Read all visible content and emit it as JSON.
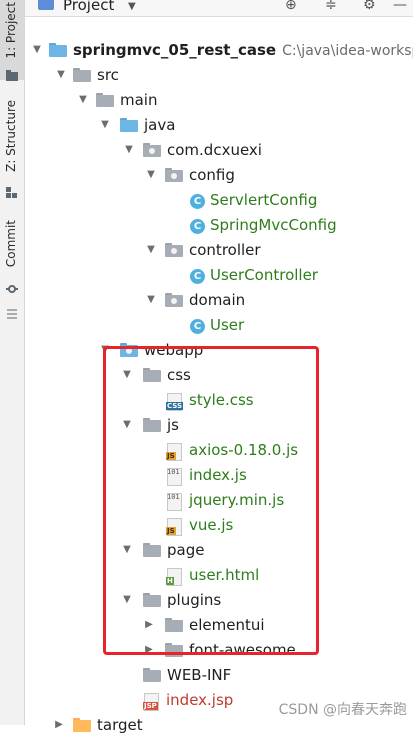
{
  "sidebar": {
    "tabs": [
      {
        "label": "1: Project",
        "icon": "folder-icon"
      },
      {
        "label": "Z: Structure",
        "icon": "structure-icon"
      },
      {
        "label": "Commit",
        "icon": "commit-icon"
      }
    ]
  },
  "header": {
    "title": "Project"
  },
  "tree": {
    "root": {
      "label": "springmvc_05_rest_case",
      "path": "C:\\java\\idea-workspa"
    },
    "items": [
      {
        "label": "src"
      },
      {
        "label": "main"
      },
      {
        "label": "java"
      },
      {
        "label": "com.dcxuexi"
      },
      {
        "label": "config"
      },
      {
        "label": "ServlertConfig"
      },
      {
        "label": "SpringMvcConfig"
      },
      {
        "label": "controller"
      },
      {
        "label": "UserController"
      },
      {
        "label": "domain"
      },
      {
        "label": "User"
      },
      {
        "label": "webapp"
      },
      {
        "label": "css"
      },
      {
        "label": "style.css"
      },
      {
        "label": "js"
      },
      {
        "label": "axios-0.18.0.js"
      },
      {
        "label": "index.js"
      },
      {
        "label": "jquery.min.js"
      },
      {
        "label": "vue.js"
      },
      {
        "label": "page"
      },
      {
        "label": "user.html"
      },
      {
        "label": "plugins"
      },
      {
        "label": "elementui"
      },
      {
        "label": "font-awesome"
      },
      {
        "label": "WEB-INF"
      },
      {
        "label": "index.jsp"
      },
      {
        "label": "target"
      }
    ]
  },
  "file_tags": {
    "css": "CSS",
    "js": "JS",
    "jsp": "JSP",
    "html": "H",
    "bin": "101"
  },
  "watermark": "CSDN @向春天奔跑",
  "colors": {
    "highlight": "#e8232b",
    "green_text": "#2e7d1c",
    "red_text": "#c03a2b",
    "class_icon": "#4fb0e0"
  }
}
